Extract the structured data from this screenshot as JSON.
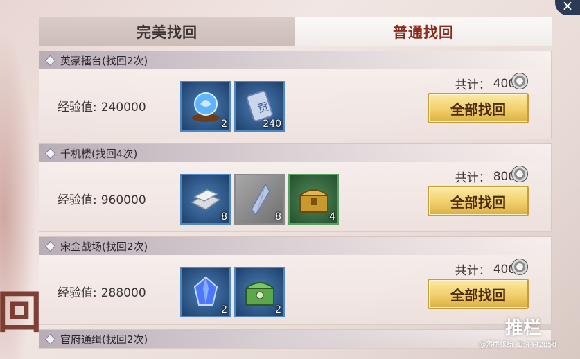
{
  "tabs": [
    {
      "label": "完美找回",
      "active": false
    },
    {
      "label": "普通找回",
      "active": true
    }
  ],
  "sections": [
    {
      "name": "英豪擂台",
      "count": "(找回2次)",
      "exp_label": "经验值:",
      "exp_value": "240000",
      "total_label": "共计：",
      "total_value": "4000",
      "button": "全部找回",
      "items": [
        {
          "icon": "crystal-orb-icon",
          "qty": "2",
          "frame": "blue"
        },
        {
          "icon": "tribute-token-icon",
          "qty": "240",
          "frame": "blue"
        }
      ]
    },
    {
      "name": "千机楼",
      "count": "(找回4次)",
      "exp_label": "经验值:",
      "exp_value": "960000",
      "total_label": "共计：",
      "total_value": "8000",
      "button": "全部找回",
      "items": [
        {
          "icon": "silver-ingot-icon",
          "qty": "8",
          "frame": "blue"
        },
        {
          "icon": "crystal-shard-icon",
          "qty": "8",
          "frame": "gray"
        },
        {
          "icon": "treasure-chest-icon",
          "qty": "4",
          "frame": "green"
        }
      ]
    },
    {
      "name": "宋金战场",
      "count": "(找回2次)",
      "exp_label": "经验值:",
      "exp_value": "288000",
      "total_label": "共计：",
      "total_value": "4000",
      "button": "全部找回",
      "items": [
        {
          "icon": "blue-gem-icon",
          "qty": "2",
          "frame": "blue"
        },
        {
          "icon": "jade-chest-icon",
          "qty": "2",
          "frame": "blue"
        }
      ]
    },
    {
      "name": "官府通缉",
      "count": "(找回2次)"
    }
  ],
  "watermark": {
    "logo": "推栏",
    "id": "@落雨缤纷 ID:4442858"
  },
  "colors": {
    "button_gold": "#f1cf6a",
    "active_tab_text": "#8a2a1a",
    "item_blue_frame": "#4f87c1",
    "item_green_frame": "#5aa060"
  }
}
